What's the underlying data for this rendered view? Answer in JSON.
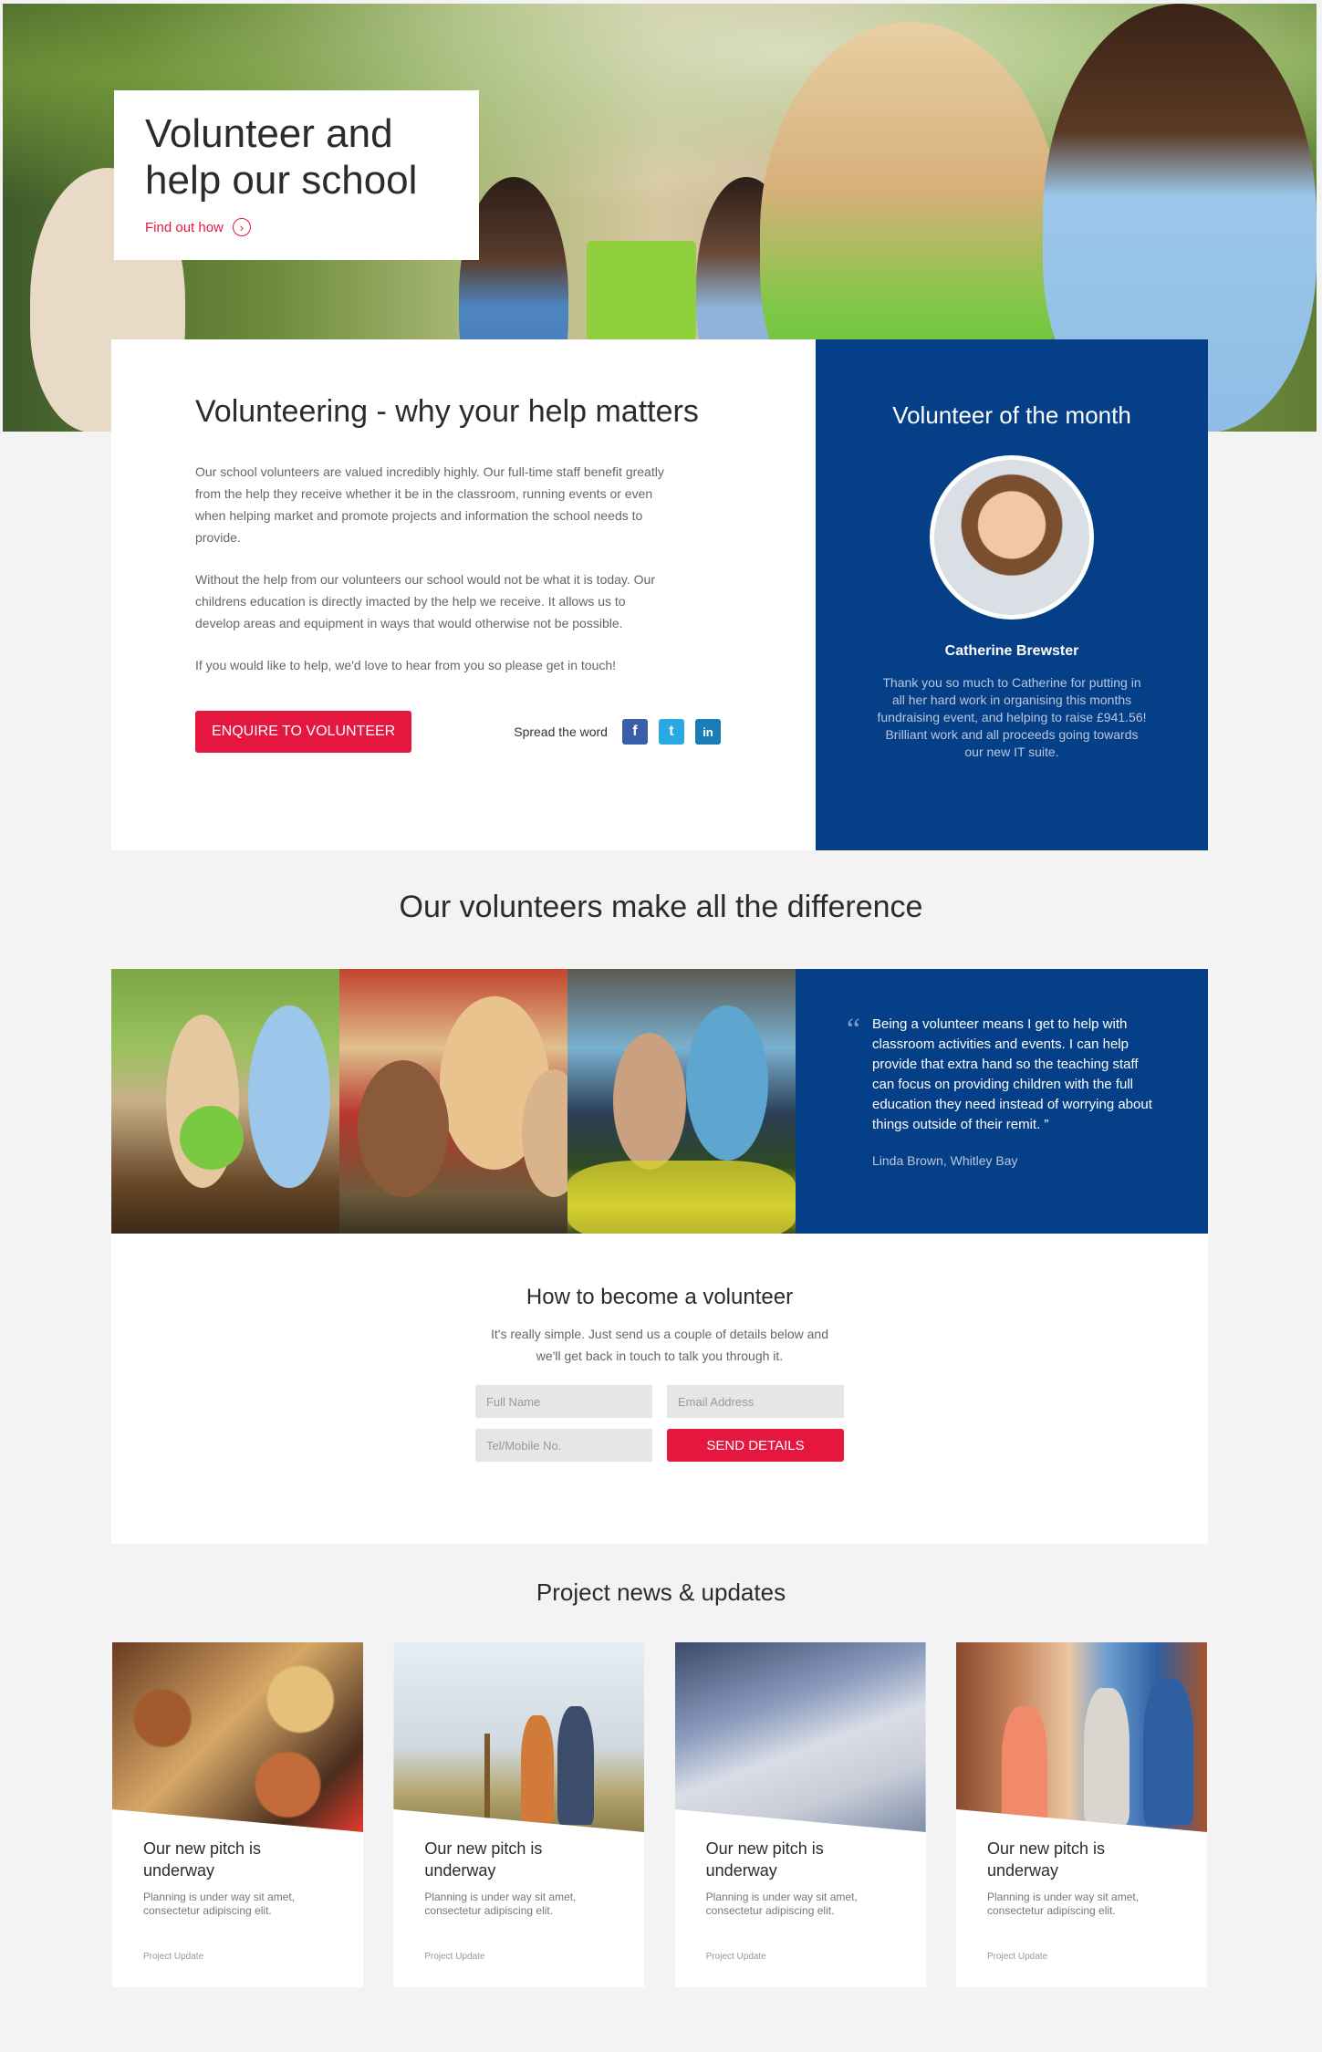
{
  "hero": {
    "title": "Volunteer and help our school",
    "link_label": "Find out how",
    "link_icon": "chevron-right-circle-icon"
  },
  "why": {
    "heading": "Volunteering - why your help matters",
    "paragraphs": [
      "Our school volunteers are valued incredibly highly. Our full-time staff benefit greatly from the help they receive whether it be in the classroom, running events or even when helping market and promote projects and information the school needs to provide.",
      "Without the help from our volunteers our school would not be what it is today. Our childrens education is directly imacted by the help we receive. It allows us to develop areas and equipment  in ways that would otherwise not be possible.",
      "If you would like to help, we'd love to hear from you so please get in touch!"
    ],
    "cta_label": "ENQUIRE TO VOLUNTEER",
    "spread_label": "Spread the word",
    "social": [
      {
        "name": "facebook-icon",
        "glyph": "f"
      },
      {
        "name": "twitter-icon",
        "glyph": "t"
      },
      {
        "name": "linkedin-icon",
        "glyph": "in"
      }
    ]
  },
  "volunteer_of_month": {
    "heading": "Volunteer of the month",
    "name": "Catherine Brewster",
    "description": "Thank you so much to Catherine for putting in all her hard work in organising this months fundraising event, and helping to raise £941.56! Brilliant work and all proceeds going towards our new IT suite."
  },
  "difference": {
    "heading": "Our volunteers make all the difference",
    "quote": "Being a volunteer means I get to help with classroom activities and events. I can help provide that extra hand so the teaching staff can focus on providing children with the full education they need instead of worrying about things outside of their remit. ”",
    "quote_mark": "“",
    "author": "Linda Brown, Whitley Bay"
  },
  "become": {
    "heading": "How to become a volunteer",
    "subtext": "It's really simple. Just send us a couple of details below and we'll get back in touch to talk you through it.",
    "fields": {
      "full_name_placeholder": "Full Name",
      "email_placeholder": "Email Address",
      "phone_placeholder": "Tel/Mobile No."
    },
    "submit_label": "SEND DETAILS"
  },
  "news": {
    "heading": "Project news & updates",
    "cards": [
      {
        "title": "Our new pitch is underway",
        "text": "Planning is under way sit amet, consectetur adipiscing elit.",
        "tag": "Project Update"
      },
      {
        "title": "Our new pitch is underway",
        "text": "Planning is under way sit amet, consectetur adipiscing elit.",
        "tag": "Project Update"
      },
      {
        "title": "Our new pitch is underway",
        "text": "Planning is under way sit amet, consectetur adipiscing elit.",
        "tag": "Project Update"
      },
      {
        "title": "Our new pitch is underway",
        "text": "Planning is under way sit amet, consectetur adipiscing elit.",
        "tag": "Project Update"
      }
    ]
  },
  "colors": {
    "accent_red": "#e5173f",
    "brand_blue": "#053f87"
  }
}
